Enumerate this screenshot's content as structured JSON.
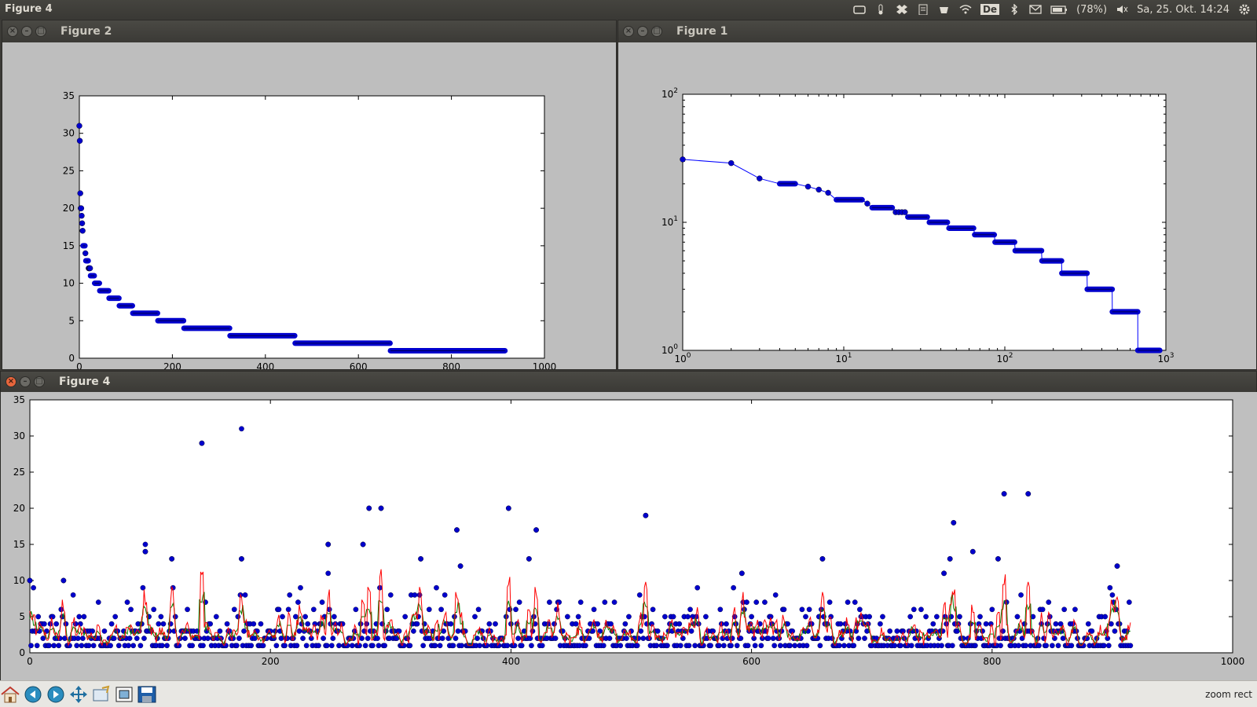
{
  "topbar": {
    "active_window_title": "Figure 4",
    "keyboard_layout": "De",
    "battery": "(78%)",
    "datetime": "Sa, 25. Okt. 14:24",
    "icons": [
      "cloud-icon",
      "thermometer-icon",
      "dropbox-icon",
      "clipboard-icon",
      "cup-icon",
      "wifi-icon",
      "keyboard-layout-icon",
      "bluetooth-icon",
      "mail-icon",
      "battery-icon",
      "volume-icon",
      "gear-icon"
    ]
  },
  "windows": {
    "figure2": {
      "title": "Figure 2"
    },
    "figure1": {
      "title": "Figure 1"
    },
    "figure4": {
      "title": "Figure 4"
    }
  },
  "toolbar": {
    "buttons": [
      "home-icon",
      "back-icon",
      "forward-icon",
      "pan-icon",
      "zoom-icon",
      "subplots-icon",
      "save-icon"
    ],
    "status": "zoom rect"
  },
  "colors": {
    "points": "#0000cc",
    "line_blue": "#0000ff",
    "line_red": "#ff0000",
    "line_green": "#008000"
  },
  "chart_data": [
    {
      "id": "figure2",
      "type": "scatter",
      "title": "",
      "xlabel": "",
      "ylabel": "",
      "xlim": [
        0,
        1000
      ],
      "ylim": [
        0,
        35
      ],
      "xticks": [
        0,
        200,
        400,
        600,
        800,
        1000
      ],
      "yticks": [
        0,
        5,
        10,
        15,
        20,
        25,
        30,
        35
      ],
      "grid": false,
      "levels": [
        {
          "y": 31,
          "x_from": 0,
          "x_to": 0
        },
        {
          "y": 29,
          "x_from": 1,
          "x_to": 1
        },
        {
          "y": 22,
          "x_from": 2,
          "x_to": 2
        },
        {
          "y": 20,
          "x_from": 3,
          "x_to": 4
        },
        {
          "y": 19,
          "x_from": 5,
          "x_to": 5
        },
        {
          "y": 18,
          "x_from": 6,
          "x_to": 6
        },
        {
          "y": 17,
          "x_from": 7,
          "x_to": 7
        },
        {
          "y": 15,
          "x_from": 8,
          "x_to": 12
        },
        {
          "y": 14,
          "x_from": 13,
          "x_to": 13
        },
        {
          "y": 13,
          "x_from": 14,
          "x_to": 19
        },
        {
          "y": 12,
          "x_from": 20,
          "x_to": 23
        },
        {
          "y": 11,
          "x_from": 24,
          "x_to": 32
        },
        {
          "y": 10,
          "x_from": 33,
          "x_to": 43
        },
        {
          "y": 9,
          "x_from": 44,
          "x_to": 63
        },
        {
          "y": 8,
          "x_from": 64,
          "x_to": 85
        },
        {
          "y": 7,
          "x_from": 86,
          "x_to": 114
        },
        {
          "y": 6,
          "x_from": 115,
          "x_to": 168
        },
        {
          "y": 5,
          "x_from": 169,
          "x_to": 224
        },
        {
          "y": 4,
          "x_from": 225,
          "x_to": 323
        },
        {
          "y": 3,
          "x_from": 324,
          "x_to": 463
        },
        {
          "y": 2,
          "x_from": 464,
          "x_to": 668
        },
        {
          "y": 1,
          "x_from": 669,
          "x_to": 915
        }
      ]
    },
    {
      "id": "figure1",
      "type": "line",
      "title": "",
      "xlabel": "",
      "ylabel": "",
      "xscale": "log",
      "yscale": "log",
      "xlim": [
        1,
        1000
      ],
      "ylim": [
        1,
        100
      ],
      "xticks": [
        1,
        10,
        100,
        1000
      ],
      "yticks": [
        1,
        10,
        100
      ],
      "xticklabels": [
        [
          "10",
          "0"
        ],
        [
          "10",
          "1"
        ],
        [
          "10",
          "2"
        ],
        [
          "10",
          "3"
        ]
      ],
      "yticklabels": [
        [
          "10",
          "0"
        ],
        [
          "10",
          "1"
        ],
        [
          "10",
          "2"
        ]
      ],
      "grid": false,
      "markers": true,
      "levels": [
        {
          "y": 31,
          "x_from": 1,
          "x_to": 1
        },
        {
          "y": 29,
          "x_from": 2,
          "x_to": 2
        },
        {
          "y": 22,
          "x_from": 3,
          "x_to": 3
        },
        {
          "y": 20,
          "x_from": 4,
          "x_to": 5
        },
        {
          "y": 19,
          "x_from": 6,
          "x_to": 6
        },
        {
          "y": 18,
          "x_from": 7,
          "x_to": 7
        },
        {
          "y": 17,
          "x_from": 8,
          "x_to": 8
        },
        {
          "y": 15,
          "x_from": 9,
          "x_to": 13
        },
        {
          "y": 14,
          "x_from": 14,
          "x_to": 14
        },
        {
          "y": 13,
          "x_from": 15,
          "x_to": 20
        },
        {
          "y": 12,
          "x_from": 21,
          "x_to": 24
        },
        {
          "y": 11,
          "x_from": 25,
          "x_to": 33
        },
        {
          "y": 10,
          "x_from": 34,
          "x_to": 44
        },
        {
          "y": 9,
          "x_from": 45,
          "x_to": 64
        },
        {
          "y": 8,
          "x_from": 65,
          "x_to": 86
        },
        {
          "y": 7,
          "x_from": 87,
          "x_to": 115
        },
        {
          "y": 6,
          "x_from": 116,
          "x_to": 169
        },
        {
          "y": 5,
          "x_from": 170,
          "x_to": 225
        },
        {
          "y": 4,
          "x_from": 226,
          "x_to": 324
        },
        {
          "y": 3,
          "x_from": 325,
          "x_to": 464
        },
        {
          "y": 2,
          "x_from": 465,
          "x_to": 669
        },
        {
          "y": 1,
          "x_from": 670,
          "x_to": 916
        }
      ]
    },
    {
      "id": "figure4",
      "type": "scatter",
      "title": "",
      "xlabel": "",
      "ylabel": "",
      "xlim": [
        0,
        1000
      ],
      "ylim": [
        0,
        35
      ],
      "xticks": [
        0,
        200,
        400,
        600,
        800,
        1000
      ],
      "yticks": [
        0,
        5,
        10,
        15,
        20,
        25,
        30,
        35
      ],
      "grid": false,
      "n_points": 916,
      "highlighted_points": [
        {
          "x": 0,
          "y": 10
        },
        {
          "x": 28,
          "y": 10
        },
        {
          "x": 96,
          "y": 15
        },
        {
          "x": 96,
          "y": 14
        },
        {
          "x": 118,
          "y": 13
        },
        {
          "x": 143,
          "y": 29
        },
        {
          "x": 176,
          "y": 31
        },
        {
          "x": 176,
          "y": 13
        },
        {
          "x": 248,
          "y": 11
        },
        {
          "x": 248,
          "y": 15
        },
        {
          "x": 277,
          "y": 15
        },
        {
          "x": 282,
          "y": 20
        },
        {
          "x": 292,
          "y": 20
        },
        {
          "x": 325,
          "y": 13
        },
        {
          "x": 355,
          "y": 17
        },
        {
          "x": 358,
          "y": 12
        },
        {
          "x": 398,
          "y": 20
        },
        {
          "x": 415,
          "y": 13
        },
        {
          "x": 421,
          "y": 17
        },
        {
          "x": 512,
          "y": 19
        },
        {
          "x": 592,
          "y": 11
        },
        {
          "x": 659,
          "y": 13
        },
        {
          "x": 760,
          "y": 11
        },
        {
          "x": 765,
          "y": 13
        },
        {
          "x": 768,
          "y": 18
        },
        {
          "x": 784,
          "y": 14
        },
        {
          "x": 805,
          "y": 13
        },
        {
          "x": 810,
          "y": 22
        },
        {
          "x": 830,
          "y": 22
        },
        {
          "x": 904,
          "y": 12
        }
      ],
      "series": [
        {
          "style": "points",
          "color": "#0000cc"
        },
        {
          "style": "line",
          "color": "#ff0000"
        },
        {
          "style": "line",
          "color": "#008000"
        }
      ]
    }
  ]
}
